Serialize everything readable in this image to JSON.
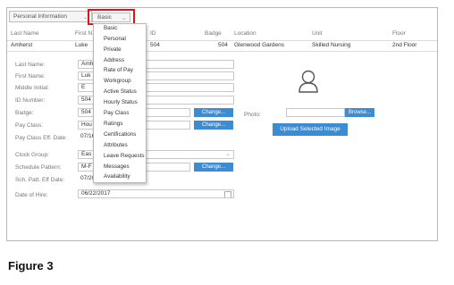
{
  "header": {
    "view_select": "Personal Information",
    "basic_select": "Basic"
  },
  "table": {
    "columns": [
      "Last Name",
      "First N",
      "ID",
      "Badge",
      "Location",
      "Unit",
      "Floor"
    ],
    "row": {
      "last_name": "Amherst",
      "first_name": "Luke",
      "id": "504",
      "badge": "504",
      "location": "Glenwood Gardens",
      "unit": "Skilled Nursing",
      "floor": "2nd Floor"
    }
  },
  "form": {
    "last_name": {
      "label": "Last Name:",
      "value": "Amh"
    },
    "first_name": {
      "label": "First Name:",
      "value": "Luk"
    },
    "middle_initial": {
      "label": "Middle Initial:",
      "value": "E"
    },
    "id_number": {
      "label": "ID Number:",
      "value": "504"
    },
    "badge": {
      "label": "Badge:",
      "value": "504"
    },
    "pay_class": {
      "label": "Pay Class:",
      "value": "Hou"
    },
    "pay_class_eff": {
      "label": "Pay Class Eff. Date:",
      "value": "07/16"
    },
    "clock_group": {
      "label": "Clock Group:",
      "value": "Eas"
    },
    "schedule_pattern": {
      "label": "Schedule Pattern:",
      "value": "M-F"
    },
    "sch_patt_eff": {
      "label": "Sch. Patt. Eff Date:",
      "value": "07/20"
    },
    "date_of_hire": {
      "label": "Date of Hire:",
      "value": "06/22/2017"
    }
  },
  "buttons": {
    "change": "Change...",
    "browse": "Browse...",
    "upload": "Upload Selected Image"
  },
  "photo_label": "Photo:",
  "dropdown_items": [
    "Basic",
    "Personal",
    "Private",
    "Address",
    "Rate of Pay",
    "Workgroup",
    "Active Status",
    "Hourly Status",
    "Pay Class",
    "Ratings",
    "Certifications",
    "Attributes",
    "Leave Requests",
    "Messages",
    "Availability"
  ],
  "caption": "Figure 3",
  "colors": {
    "accent_blue": "#3d8bd1",
    "highlight_red": "#d21a1a"
  }
}
